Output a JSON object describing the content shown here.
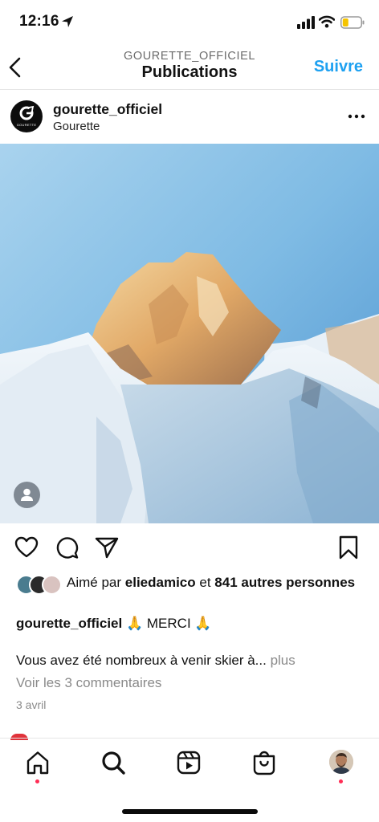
{
  "status_bar": {
    "time": "12:16",
    "icons": [
      "location-arrow-icon",
      "signal-icon",
      "wifi-icon",
      "battery-icon"
    ],
    "battery_color": "#f5c400"
  },
  "header": {
    "account": "GOURETTE_OFFICIEL",
    "title": "Publications",
    "follow_label": "Suivre",
    "back_icon": "chevron-left-icon",
    "accent_color": "#1ea1f1"
  },
  "post": {
    "username": "gourette_officiel",
    "location": "Gourette",
    "avatar_text": "GOURETTE",
    "more_icon": "more-horizontal-icon",
    "likes": {
      "prefix": "Aimé par",
      "liker": "eliedamico",
      "connector": "et",
      "others": "841 autres personnes"
    },
    "caption": {
      "author": "gourette_officiel",
      "emoji": "🙏",
      "text": "MERCI",
      "line2": "Vous avez été nombreux à venir skier à...",
      "more": "plus"
    },
    "view_comments": "Voir les 3 commentaires",
    "date": "3 avril"
  },
  "tab_bar": {
    "items": [
      "home-icon",
      "search-icon",
      "reels-icon",
      "shop-icon",
      "profile-avatar"
    ]
  }
}
